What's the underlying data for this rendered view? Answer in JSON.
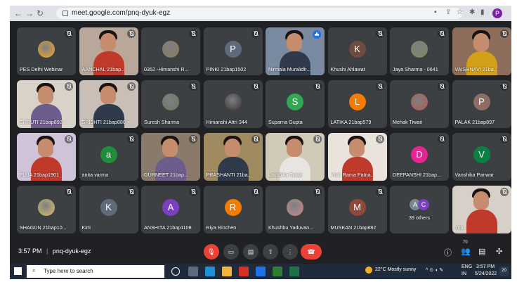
{
  "browser": {
    "url": "meet.google.com/pnq-dyuk-egz",
    "profile_initial": "P"
  },
  "tiles": [
    {
      "name": "PES Delhi Webinar",
      "type": "image",
      "color": "#f5a623"
    },
    {
      "name": "AANCHAL 21bap...",
      "type": "video",
      "bg": "#b9a79a"
    },
    {
      "name": "0352 -Himanshi R...",
      "type": "image",
      "color": "#8d7a5a"
    },
    {
      "name": "PINKI 21bap1502",
      "type": "initial",
      "initial": "P",
      "color": "#5f6b7a"
    },
    {
      "name": "Nirmala Muralidh...",
      "type": "video",
      "bg": "#7a8aa0",
      "speaking": true
    },
    {
      "name": "Khushi Ahlawat",
      "type": "initial",
      "initial": "K",
      "color": "#6d4c41"
    },
    {
      "name": "Jaya Sharma - 0641",
      "type": "image",
      "color": "#7c8a5c"
    },
    {
      "name": "VAISHNAVI 21ba...",
      "type": "video",
      "bg": "#8c6e5a"
    },
    {
      "name": "SHRUTI 21bap892",
      "type": "video",
      "bg": "#d9d2c8"
    },
    {
      "name": "SRISHTI 21bap880",
      "type": "video",
      "bg": "#c9bfb6"
    },
    {
      "name": "Suresh Sharma",
      "type": "image",
      "color": "#6b7a60"
    },
    {
      "name": "Himanshi Attri 344",
      "type": "image",
      "color": "#3b3030"
    },
    {
      "name": "Suparna Gupta",
      "type": "initial",
      "initial": "S",
      "color": "#33a852"
    },
    {
      "name": "LATIKA 21bap579",
      "type": "initial",
      "initial": "L",
      "color": "#f57c00"
    },
    {
      "name": "Mehak Tiwari",
      "type": "image",
      "color": "#b65a4a"
    },
    {
      "name": "PALAK 21bap897",
      "type": "initial",
      "initial": "P",
      "color": "#8d6e63"
    },
    {
      "name": "PUJA 21bap1901",
      "type": "video",
      "bg": "#cfc3d9"
    },
    {
      "name": "anita varma",
      "type": "initial",
      "initial": "a",
      "color": "#1e8e3e"
    },
    {
      "name": "GURNEET 21bap...",
      "type": "video",
      "bg": "#8a7a6c"
    },
    {
      "name": "PRASHANTI 21ba...",
      "type": "video",
      "bg": "#a08a60"
    },
    {
      "name": "Lakshika Tyagi",
      "type": "video",
      "bg": "#d2cab8"
    },
    {
      "name": "Prof. Rama Patna...",
      "type": "video",
      "bg": "#e9e3dc",
      "wide": true
    },
    {
      "name": "DEEPANSHI 21bap...",
      "type": "initial",
      "initial": "D",
      "color": "#e52592"
    },
    {
      "name": "Vanshika Panwar",
      "type": "initial",
      "initial": "V",
      "color": "#0b8043"
    },
    {
      "name": "SHAGUN 21bap10...",
      "type": "image",
      "color": "#d9c06a"
    },
    {
      "name": "Kirti",
      "type": "initial",
      "initial": "K",
      "color": "#5f6b7a"
    },
    {
      "name": "ANSHITA 21bap1108",
      "type": "initial",
      "initial": "A",
      "color": "#7b3fbf"
    },
    {
      "name": "Riya Rinchen",
      "type": "initial",
      "initial": "R",
      "color": "#f57c00"
    },
    {
      "name": "Khushbu Yaduvan...",
      "type": "image",
      "color": "#c98a8a"
    },
    {
      "name": "MUSKAN 21bap882",
      "type": "initial",
      "initial": "M",
      "color": "#8d4a3a"
    },
    {
      "name": "39 others",
      "type": "others",
      "initials": [
        "A",
        "C"
      ]
    },
    {
      "name": "You",
      "type": "video",
      "bg": "#d6d0c8"
    }
  ],
  "bottom": {
    "time": "3:57 PM",
    "separator": "|",
    "meeting_code": "pnq-dyuk-egz",
    "participants_count": "70"
  },
  "taskbar": {
    "search_placeholder": "Type here to search",
    "weather": "22°C  Mostly sunny",
    "lang_top": "ENG",
    "lang_bottom": "IN",
    "time": "3:57 PM",
    "date": "5/24/2022",
    "notification_count": "20"
  }
}
